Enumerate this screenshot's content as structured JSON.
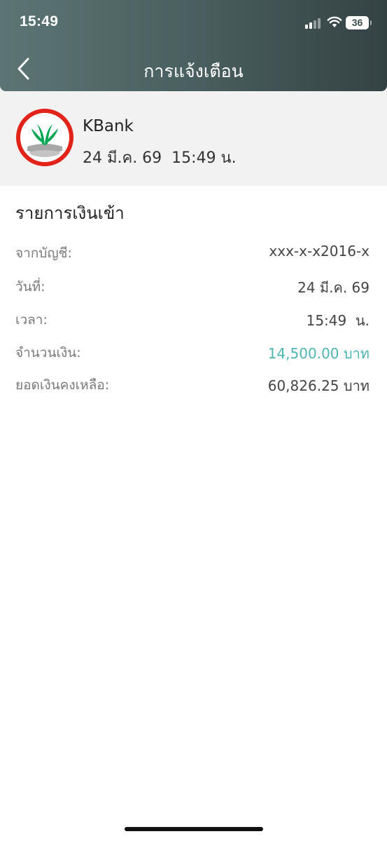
{
  "status_bar": {
    "time": "15:49",
    "battery": "36"
  },
  "nav": {
    "title": "การแจ้งเตือน",
    "back_icon": "chevron-left-icon"
  },
  "sender": {
    "name": "KBank",
    "datetime": "24 มี.ค. 69  15:49 น.",
    "logo_icon": "kbank-logo-icon"
  },
  "section": {
    "title": "รายการเงินเข้า"
  },
  "details": [
    {
      "label": "จากบัญชี:",
      "value": "xxx-x-x2016-x"
    },
    {
      "label": "วันที่:",
      "value": "24 มี.ค. 69"
    },
    {
      "label": "เวลา:",
      "value": "15:49  น."
    },
    {
      "label": "จำนวนเงิน:",
      "value": "14,500.00 บาท"
    },
    {
      "label": "ยอดเงินคงเหลือ:",
      "value": "60,826.25 บาท"
    }
  ],
  "colors": {
    "header": "#4a5f5f",
    "amount": "#4fb5b0",
    "logo_ring": "#e2231a",
    "logo_green": "#00a650"
  }
}
